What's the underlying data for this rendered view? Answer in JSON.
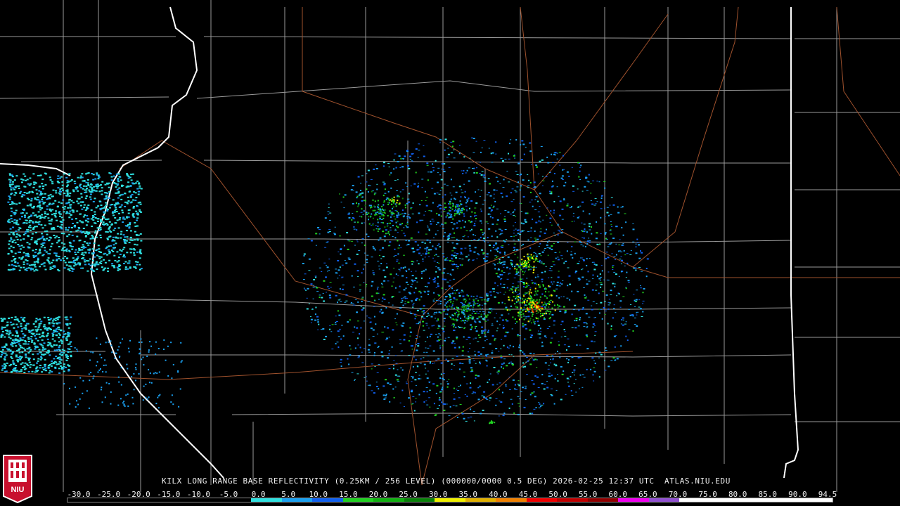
{
  "product": {
    "caption": "KILX LONG RANGE BASE REFLECTIVITY (0.25KM / 256 LEVEL) (000000/0000 0.5 DEG) 2026-02-25 12:37 UTC  ATLAS.NIU.EDU",
    "logo_text": "NIU",
    "logo_colors": {
      "red": "#c8102e",
      "white": "#ffffff"
    }
  },
  "scale": {
    "ticks": [
      "-30.0",
      "-25.0",
      "-20.0",
      "-15.0",
      "-10.0",
      "-5.0",
      "0.0",
      "5.0",
      "10.0",
      "15.0",
      "20.0",
      "25.0",
      "30.0",
      "35.0",
      "40.0",
      "45.0",
      "50.0",
      "55.0",
      "60.0",
      "65.0",
      "70.0",
      "75.0",
      "80.0",
      "85.0",
      "90.0",
      "94.5"
    ],
    "segment_colors": [
      "#000000",
      "#000000",
      "#000000",
      "#000000",
      "#000000",
      "#000000",
      "#2fe0e0",
      "#1aa0f0",
      "#1060f0",
      "#20d020",
      "#10b010",
      "#088008",
      "#f0f000",
      "#e0b000",
      "#f08000",
      "#f00000",
      "#c00000",
      "#900000",
      "#f000f0",
      "#9050d0",
      "#ffffff",
      "#ffffff",
      "#ffffff",
      "#ffffff",
      "#ffffff"
    ]
  },
  "map": {
    "state_border_color": "#ffffff",
    "county_line_color": "#9a9a9a",
    "highway_color": "#a0522d",
    "echo_colors": {
      "light": "#2fe0e0",
      "mid": "#1aa0f0",
      "deep": "#1060f0",
      "green": "#20d020",
      "dkgreen": "#088008",
      "yellow": "#f0f000",
      "orange": "#f08000",
      "red": "#f00000"
    }
  }
}
